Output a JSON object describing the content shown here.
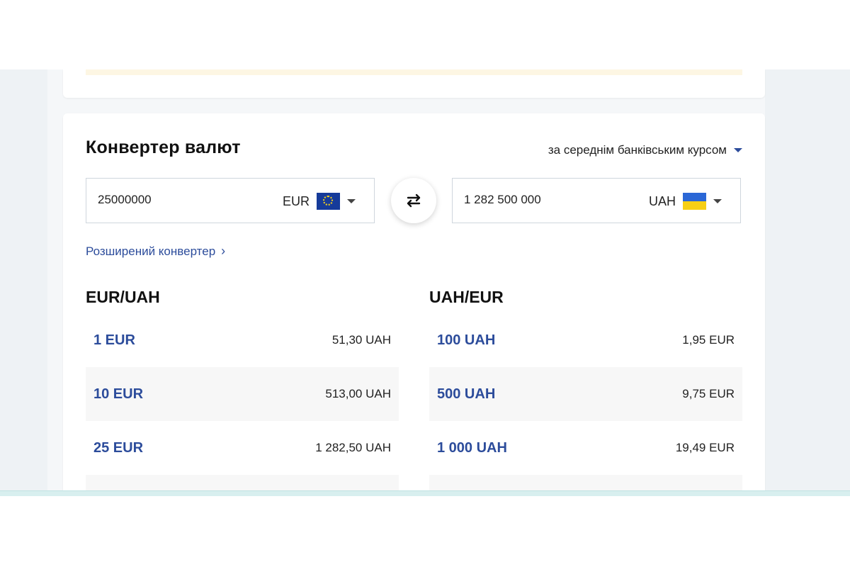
{
  "converter": {
    "title": "Конвертер валют",
    "rate_mode": "за середнім банківським курсом",
    "from": {
      "amount": "25000000",
      "currency": "EUR",
      "flag_icon": "eu-flag-icon"
    },
    "to": {
      "amount": "1 282 500 000",
      "currency": "UAH",
      "flag_icon": "ua-flag-icon"
    },
    "advanced_link": "Розширений конвертер"
  },
  "tables": [
    {
      "title": "EUR/UAH",
      "rows": [
        {
          "key": "1 EUR",
          "value": "51,30 UAH"
        },
        {
          "key": "10 EUR",
          "value": "513,00 UAH"
        },
        {
          "key": "25 EUR",
          "value": "1 282,50 UAH"
        }
      ]
    },
    {
      "title": "UAH/EUR",
      "rows": [
        {
          "key": "100 UAH",
          "value": "1,95 EUR"
        },
        {
          "key": "500 UAH",
          "value": "9,75 EUR"
        },
        {
          "key": "1 000 UAH",
          "value": "19,49 EUR"
        }
      ]
    }
  ],
  "colors": {
    "accent": "#2c4c9b",
    "background": "#eef2f5",
    "notice": "#fdf6e3"
  }
}
